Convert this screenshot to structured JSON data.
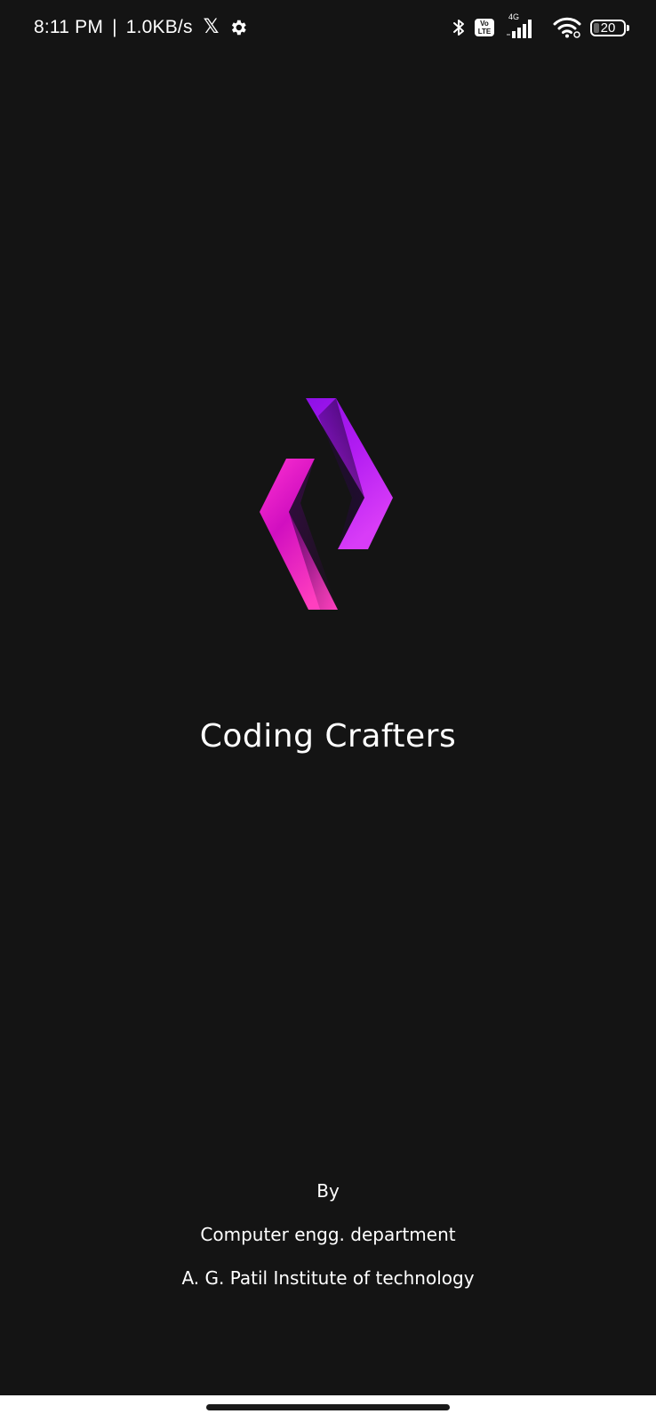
{
  "status_bar": {
    "time": "8:11 PM",
    "separator": "|",
    "net_speed": "1.0KB/s",
    "network_type": "4G",
    "volte_top": "Vo",
    "volte_bottom": "LTE",
    "battery": "20",
    "battery_level": 0.2,
    "icons": [
      "x-app-icon",
      "settings-gear-icon",
      "bluetooth-icon",
      "volte-icon",
      "signal-icon",
      "wifi-icon",
      "battery-icon"
    ]
  },
  "splash": {
    "app_name": "Coding Crafters",
    "logo": "coding-crafters-logo",
    "colors": {
      "background": "#141414",
      "logo_magenta": "#ec1fc8",
      "logo_purple": "#a51bf0",
      "logo_violet": "#7b0ed8"
    }
  },
  "credits": {
    "by": "By",
    "department": "Computer engg. department",
    "institute": "A. G. Patil Institute of technology"
  },
  "nav": {
    "home_indicator": "home-indicator"
  }
}
